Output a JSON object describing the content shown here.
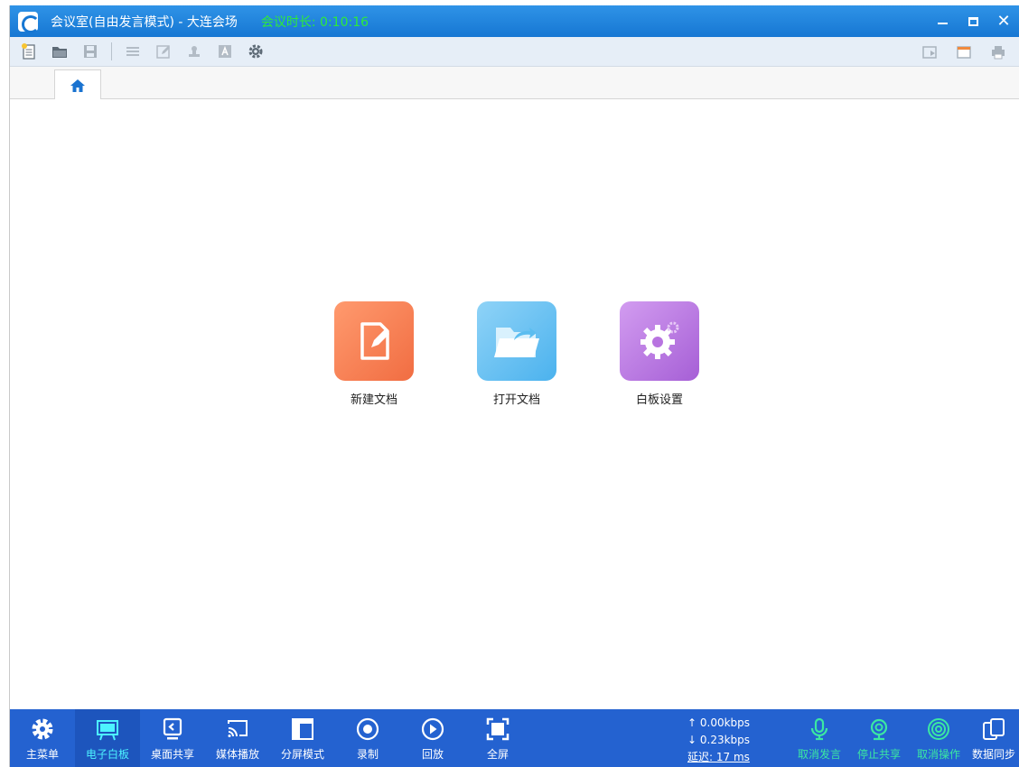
{
  "window": {
    "title": "会议室(自由发言模式) - 大连会场",
    "duration": "会议时长: 0:10:16"
  },
  "tabs": [
    {
      "icon": "home-icon"
    }
  ],
  "content": {
    "tiles": [
      {
        "label": "新建文档",
        "icon": "new-document-icon",
        "color": "#f47a4f"
      },
      {
        "label": "打开文档",
        "icon": "open-folder-icon",
        "color": "#5bbdf0"
      },
      {
        "label": "白板设置",
        "icon": "whiteboard-settings-icon",
        "color": "#b874e0"
      }
    ]
  },
  "bottombar": {
    "items": [
      {
        "label": "主菜单",
        "icon": "gear-icon"
      },
      {
        "label": "电子白板",
        "icon": "whiteboard-icon",
        "active": true
      },
      {
        "label": "桌面共享",
        "icon": "desktop-share-icon"
      },
      {
        "label": "媒体播放",
        "icon": "media-cast-icon"
      },
      {
        "label": "分屏模式",
        "icon": "split-screen-icon"
      },
      {
        "label": "录制",
        "icon": "record-icon"
      },
      {
        "label": "回放",
        "icon": "play-icon"
      },
      {
        "label": "全屏",
        "icon": "fullscreen-icon"
      }
    ],
    "stats": {
      "upload": "↑ 0.00kbps",
      "download": "↓ 0.23kbps",
      "delay": "延迟: 17 ms"
    },
    "right_items": [
      {
        "label": "取消发言",
        "icon": "microphone-icon"
      },
      {
        "label": "停止共享",
        "icon": "webcam-icon"
      },
      {
        "label": "取消操作",
        "icon": "target-icon"
      },
      {
        "label": "数据同步",
        "icon": "data-sync-icon"
      }
    ]
  },
  "colors": {
    "titlebar": "#1e84dc",
    "bottombar": "#2462d0",
    "active_text": "#4df3ff",
    "status_green": "#3be8a2",
    "duration_green": "#2eea3a"
  }
}
